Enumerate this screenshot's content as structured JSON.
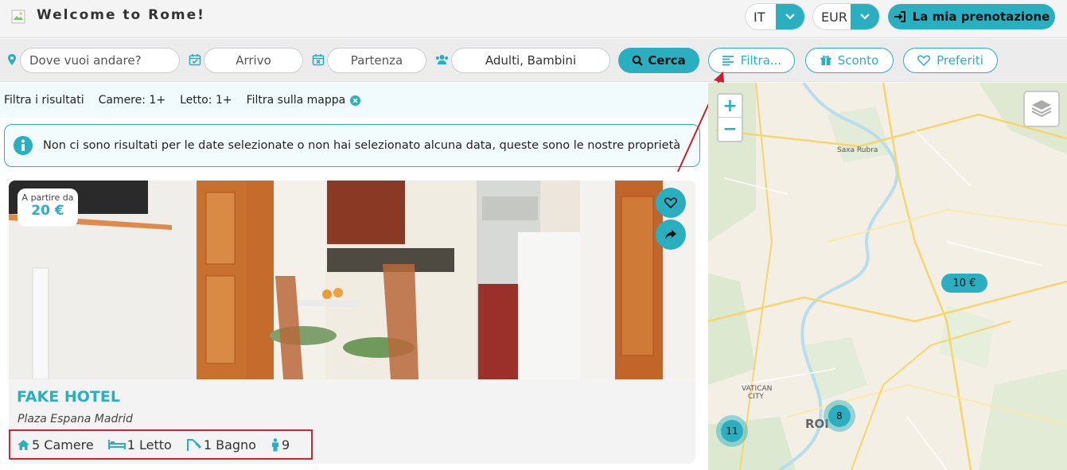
{
  "header": {
    "title": "Welcome to Rome!",
    "language": "IT",
    "currency": "EUR",
    "booking_label": "La mia prenotazione"
  },
  "search": {
    "destination_placeholder": "Dove vuoi andare?",
    "checkin_placeholder": "Arrivo",
    "checkout_placeholder": "Partenza",
    "guests_label": "Adulti, Bambini",
    "search_label": "Cerca",
    "filter_label": "Filtra...",
    "discount_label": "Sconto",
    "favorites_label": "Preferiti"
  },
  "filters": {
    "label": "Filtra i risultati",
    "rooms": "Camere: 1+",
    "beds": "Letto: 1+",
    "map_filter": "Filtra sulla mappa"
  },
  "alert": {
    "message": "Non ci sono risultati per le date selezionate o non hai selezionato alcuna data, queste sono le nostre proprietà"
  },
  "listing": {
    "price_prefix": "A partire da",
    "price": "20 €",
    "name": "FAKE HOTEL",
    "address": "Plaza Espana Madrid",
    "rooms": "5 Camere",
    "beds": "1 Letto",
    "baths": "1 Bagno",
    "guests": "9"
  },
  "map": {
    "price_marker": "10 €",
    "cluster_a": "8",
    "cluster_b": "11",
    "place_saxa": "Saxa Rubra",
    "place_vatican_1": "VATICAN",
    "place_vatican_2": "CITY",
    "place_rome": "ROI"
  },
  "colors": {
    "accent": "#2aafc0",
    "highlight_box": "#d5222c"
  }
}
